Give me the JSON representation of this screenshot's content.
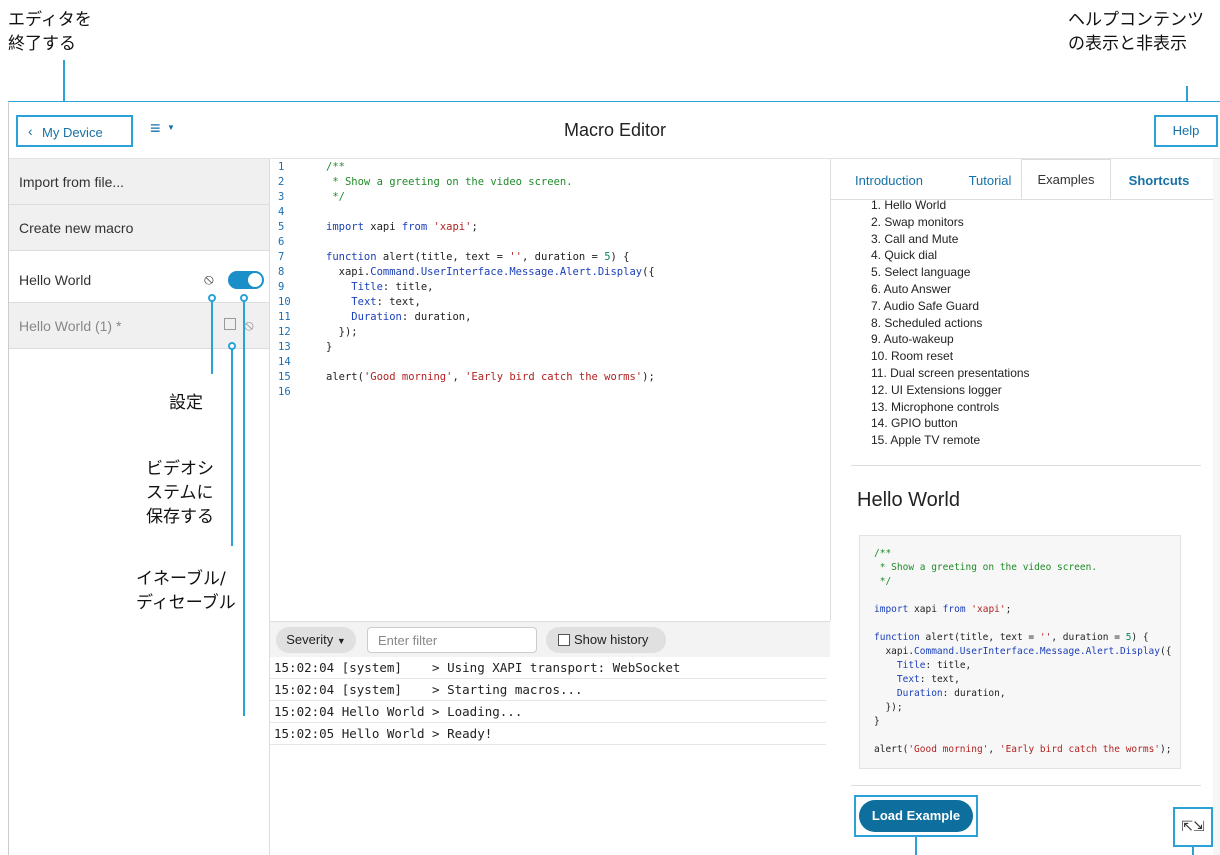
{
  "annotations": {
    "exit_editor": "エディタを\n終了する",
    "help_toggle": "ヘルプコンテンツ\nの表示と非表示",
    "settings": "設定",
    "save_to_system": "ビデオシ\nステムに\n保存する",
    "enable_disable": "イネーブル/\nディセーブル"
  },
  "topbar": {
    "back_label": "My Device",
    "title": "Macro Editor",
    "help_label": "Help"
  },
  "sidebar": {
    "items": [
      {
        "label": "Import from file..."
      },
      {
        "label": "Create new macro"
      },
      {
        "label": "Hello World"
      },
      {
        "label": "Hello World (1) *"
      }
    ]
  },
  "editor": {
    "line_numbers": [
      "1",
      "2",
      "3",
      "4",
      "5",
      "6",
      "7",
      "8",
      "9",
      "10",
      "11",
      "12",
      "13",
      "14",
      "15",
      "16"
    ]
  },
  "log": {
    "severity_label": "Severity",
    "filter_placeholder": "Enter filter",
    "show_history_label": "Show history",
    "rows": [
      "15:02:04 [system]    > Using XAPI transport: WebSocket",
      "15:02:04 [system]    > Starting macros...",
      "15:02:04 Hello World > Loading...",
      "15:02:05 Hello World > Ready!"
    ]
  },
  "help": {
    "tabs": [
      "Introduction",
      "Tutorial",
      "Examples",
      "Shortcuts"
    ],
    "active_tab": "Examples",
    "examples": [
      "1. Hello World",
      "2. Swap monitors",
      "3. Call and Mute",
      "4. Quick dial",
      "5. Select language",
      "6. Auto Answer",
      "7. Audio Safe Guard",
      "8. Scheduled actions",
      "9. Auto-wakeup",
      "10. Room reset",
      "11. Dual screen presentations",
      "12. UI Extensions logger",
      "13. Microphone controls",
      "14. GPIO button",
      "15. Apple TV remote"
    ],
    "example_title": "Hello World",
    "load_example_label": "Load Example"
  },
  "colors": {
    "accent": "#2aa2d8",
    "primary_button": "#0e6e9e",
    "toggle_on": "#1a8fc8"
  }
}
